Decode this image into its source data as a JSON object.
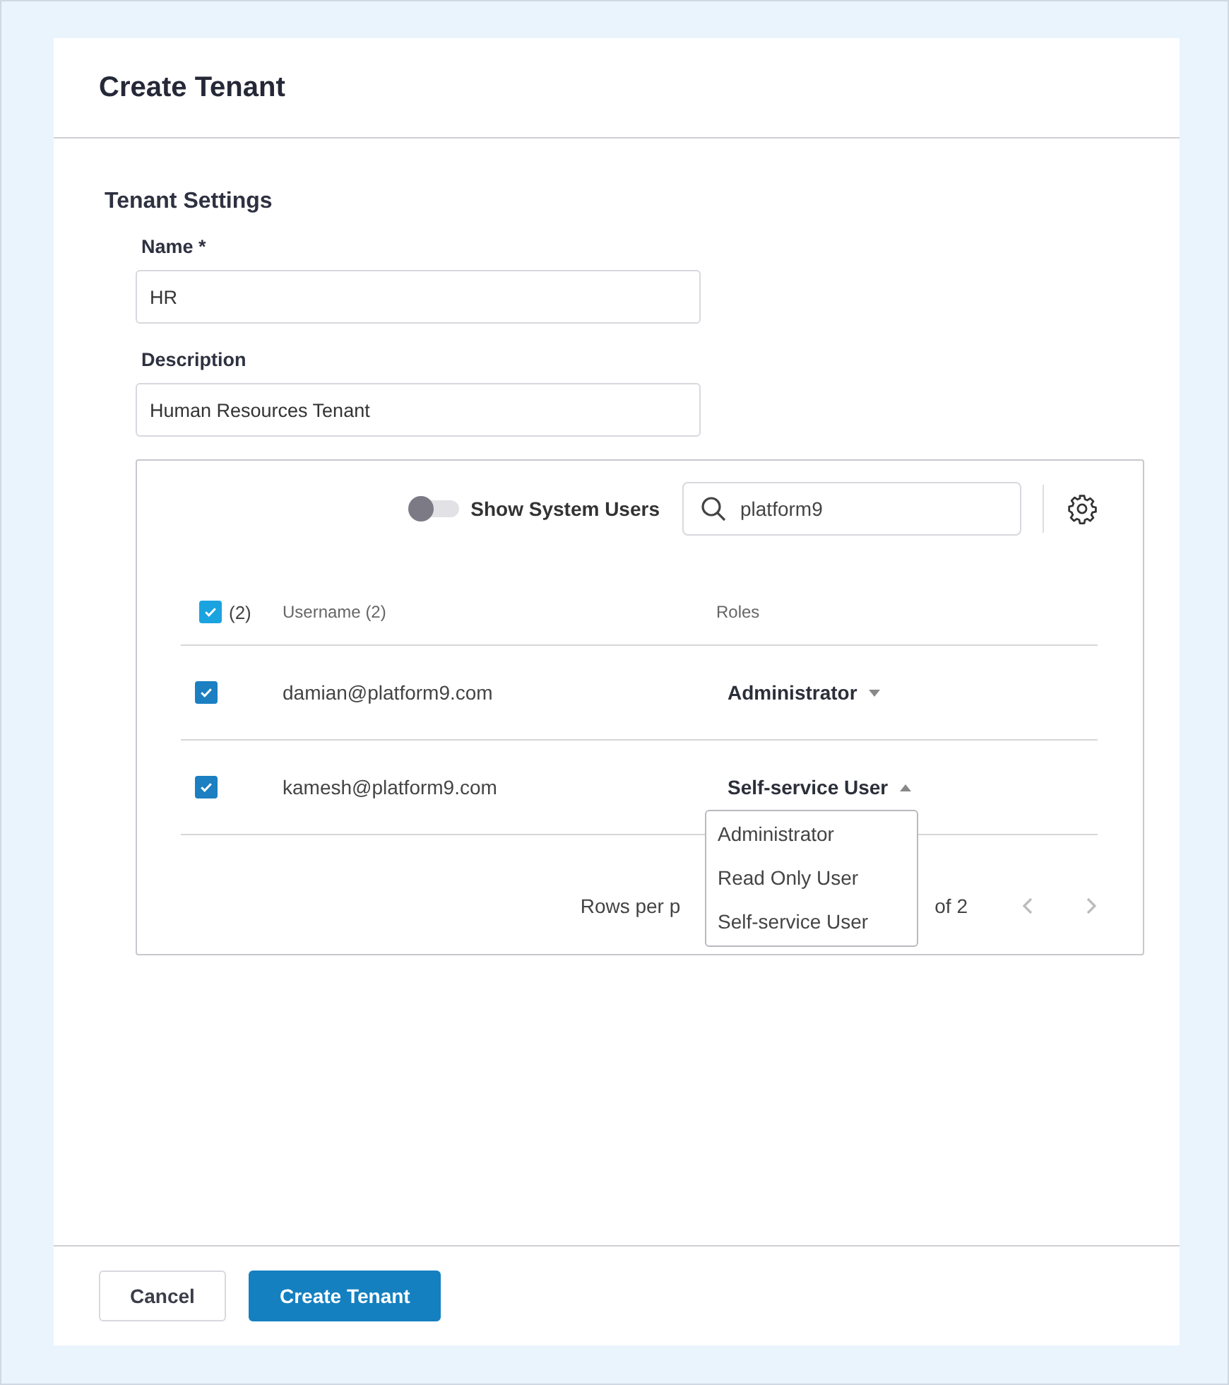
{
  "dialog": {
    "title": "Create Tenant"
  },
  "section": {
    "title": "Tenant Settings"
  },
  "fields": [
    {
      "label": "Name *",
      "value": "HR"
    },
    {
      "label": "Description",
      "value": "Human Resources Tenant"
    }
  ],
  "users_panel": {
    "toggle": {
      "label": "Show System Users",
      "on": false
    },
    "search": {
      "value": "platform9"
    },
    "table": {
      "select_all": {
        "checked": true,
        "count": "(2)"
      },
      "columns": [
        "Username (2)",
        "Roles"
      ],
      "rows": [
        {
          "checked": true,
          "username": "damian@platform9.com",
          "role": "Administrator",
          "expanded": false
        },
        {
          "checked": true,
          "username": "kamesh@platform9.com",
          "role": "Self-service User",
          "expanded": true
        }
      ]
    },
    "role_menu": {
      "items": [
        "Administrator",
        "Read Only User",
        "Self-service User"
      ]
    },
    "pagination": {
      "rows_label": "Rows per p",
      "range": "of 2"
    }
  },
  "buttons": [
    {
      "label": "Cancel",
      "kind": "secondary"
    },
    {
      "label": "Create Tenant",
      "kind": "primary"
    }
  ]
}
